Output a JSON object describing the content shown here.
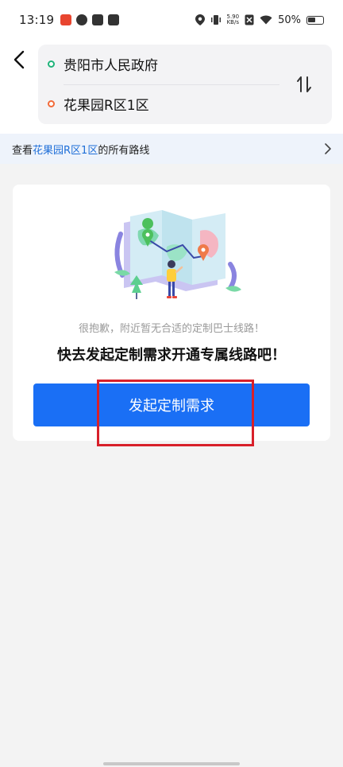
{
  "status_bar": {
    "time": "13:19",
    "net_speed_value": "5.90",
    "net_speed_unit": "KB/s",
    "battery": "50%"
  },
  "route": {
    "start": "贵阳市人民政府",
    "end": "花果园R区1区"
  },
  "routes_bar": {
    "prefix": "查看",
    "stop_link": "花果园R区1区",
    "suffix": "的所有路线"
  },
  "empty_state": {
    "sorry": "很抱歉，附近暂无合适的定制巴士线路！",
    "cta": "快去发起定制需求开通专属线路吧！",
    "button_label": "发起定制需求"
  },
  "colors": {
    "primary": "#1a6ff5",
    "start_dot": "#1fb37a",
    "end_dot": "#f26b3a",
    "link": "#1f6fd8",
    "highlight": "#d8202a"
  }
}
